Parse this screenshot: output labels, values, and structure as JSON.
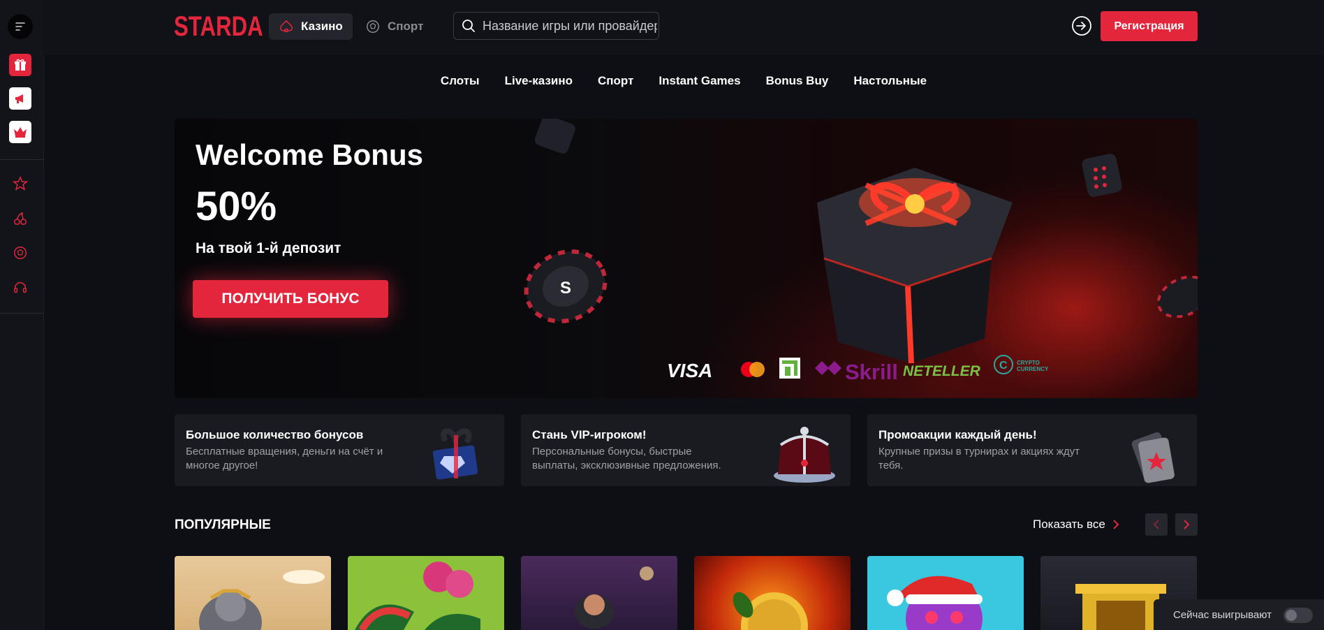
{
  "header": {
    "logo": "STARDA",
    "tabs": [
      {
        "label": "Казино",
        "active": true
      },
      {
        "label": "Спорт",
        "active": false
      }
    ],
    "search": {
      "placeholder": "Название игры или провайдера"
    },
    "register_label": "Регистрация"
  },
  "categories": [
    "Слоты",
    "Live-казино",
    "Спорт",
    "Instant Games",
    "Bonus Buy",
    "Настольные"
  ],
  "banner": {
    "title": "Welcome Bonus",
    "percent": "50%",
    "subtitle": "На твой 1-й депозит",
    "cta": "ПОЛУЧИТЬ БОНУС",
    "payments": [
      "VISA",
      "mastercard",
      "privat",
      "Skrill",
      "NETELLER",
      "CRYPTO CURRENCY"
    ]
  },
  "features": [
    {
      "title": "Большое количество бонусов",
      "text": "Бесплатные вращения, деньги на счёт и многое другое!"
    },
    {
      "title": "Стань VIP-игроком!",
      "text": "Персональные бонусы, быстрые выплаты, эксклюзивные предложения."
    },
    {
      "title": "Промоакции каждый день!",
      "text": "Крупные призы в турнирах и акциях ждут тебя."
    }
  ],
  "popular": {
    "title": "ПОПУЛЯРНЫЕ",
    "show_all": "Показать все"
  },
  "winning_now": {
    "label": "Сейчас выигрывают",
    "enabled": false
  },
  "colors": {
    "accent": "#e4263d",
    "background": "#0e0f14"
  }
}
